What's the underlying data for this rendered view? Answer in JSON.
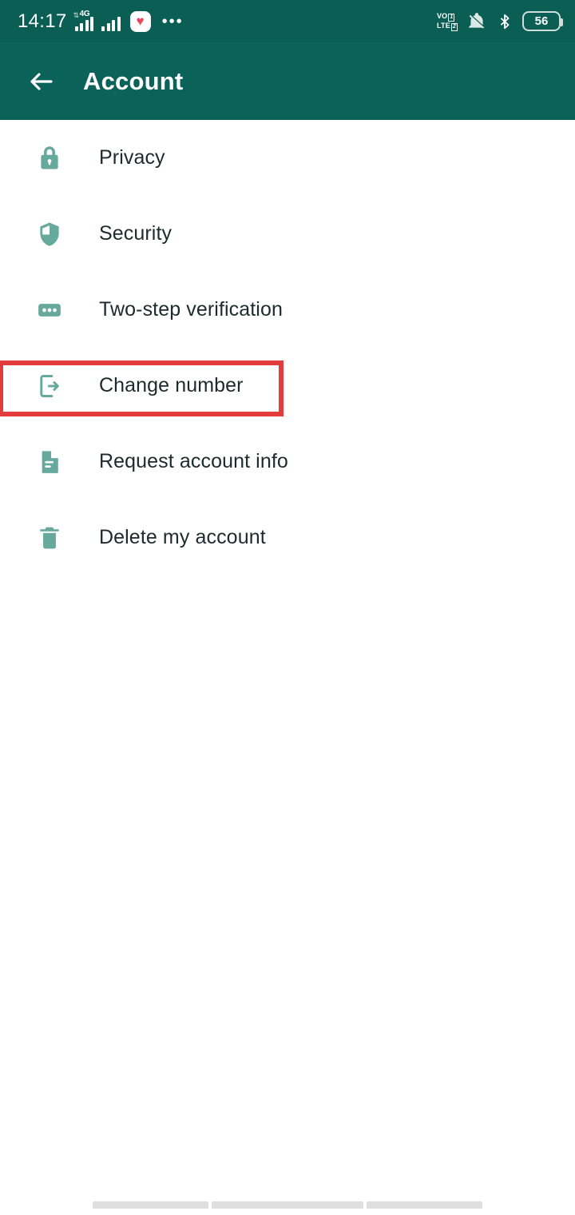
{
  "status_bar": {
    "clock": "14:17",
    "network_label": "4G",
    "volte_line1": "VO",
    "volte_line2": "LTE",
    "volte_badge1": "1",
    "volte_badge2": "2",
    "battery_level": "56",
    "more_dots": "•••",
    "heart_glyph": "♥",
    "icons": [
      "signal-4g-icon",
      "signal-bars-icon",
      "health-app-icon",
      "more-dots-icon",
      "volte-icon",
      "mute-bell-icon",
      "bluetooth-icon",
      "battery-icon"
    ]
  },
  "app_bar": {
    "title": "Account",
    "back_icon": "back-arrow-icon"
  },
  "account_list": {
    "items": [
      {
        "label": "Privacy",
        "icon": "lock-icon",
        "highlighted": false
      },
      {
        "label": "Security",
        "icon": "shield-icon",
        "highlighted": false
      },
      {
        "label": "Two-step verification",
        "icon": "dots-card-icon",
        "highlighted": false
      },
      {
        "label": "Change number",
        "icon": "change-number-icon",
        "highlighted": true
      },
      {
        "label": "Request account info",
        "icon": "document-icon",
        "highlighted": false
      },
      {
        "label": "Delete my account",
        "icon": "trash-icon",
        "highlighted": false
      }
    ]
  },
  "nav_bar": {
    "segments": [
      "recents-key",
      "home-key",
      "back-key"
    ]
  },
  "colors": {
    "status_bar": "#0b5e54",
    "app_bar": "#0a6259",
    "page_background": "#ffffff",
    "icon_teal": "#67a99c",
    "label_text": "#1d2a2e",
    "highlight_red": "#e23c3c",
    "nav_segment": "#dedede"
  }
}
